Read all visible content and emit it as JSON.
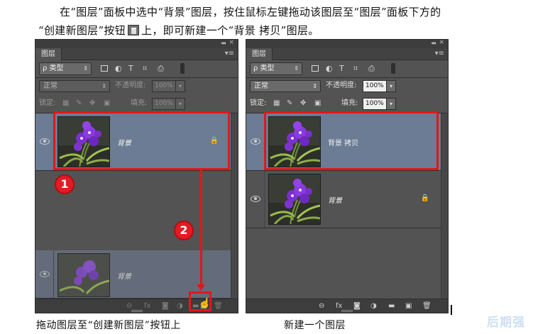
{
  "intro": {
    "line1": "在“图层”面板中选中“背景”图层，按住鼠标左键拖动该图层至“图层”面板下方的",
    "line2_pre": "“创建新图层”按钮",
    "line2_post": "上，即可新建一个“背景 拷贝”图层。"
  },
  "panel_left": {
    "tab": "图层",
    "filter": "ρ 类型",
    "blend": "正常",
    "opacity_label": "不透明度:",
    "opacity_value": "100%",
    "lock_label": "锁定:",
    "fill_label": "填充:",
    "fill_value": "100%",
    "layer_name": "背景",
    "ghost_name": "背景"
  },
  "panel_right": {
    "tab": "图层",
    "filter": "ρ 类型",
    "blend": "正常",
    "opacity_label": "不透明度:",
    "opacity_value": "100%",
    "lock_label": "锁定:",
    "fill_label": "填充:",
    "fill_value": "100%",
    "layer_copy_name": "背景 拷贝",
    "layer_name": "背景"
  },
  "badges": {
    "one": "1",
    "two": "2"
  },
  "icons": {
    "filter_icons": [
      "image-filter-icon",
      "adjustment-filter-icon",
      "type-filter-icon",
      "shape-filter-icon",
      "smart-object-filter-icon"
    ],
    "filter_glyphs": [
      "▣",
      "◐",
      "T",
      "⌗",
      "⎙"
    ],
    "lock_glyphs": [
      "▦",
      "✎",
      "✥",
      "🔒"
    ],
    "footer_glyphs": [
      "⊖",
      "fx",
      "◙",
      "◑",
      "▬",
      "▣",
      "🗑"
    ],
    "lock_icon": "🔒",
    "eye_icon": "eye-icon",
    "hand_cursor": "☝"
  },
  "captions": {
    "left": "拖动图层至“创建新图层”按钮上",
    "right": "新建一个图层"
  },
  "watermark": "后期强",
  "colors": {
    "panel_bg": "#535353",
    "selected_layer": "#6b7c94",
    "highlight_red": "#e3161d"
  }
}
